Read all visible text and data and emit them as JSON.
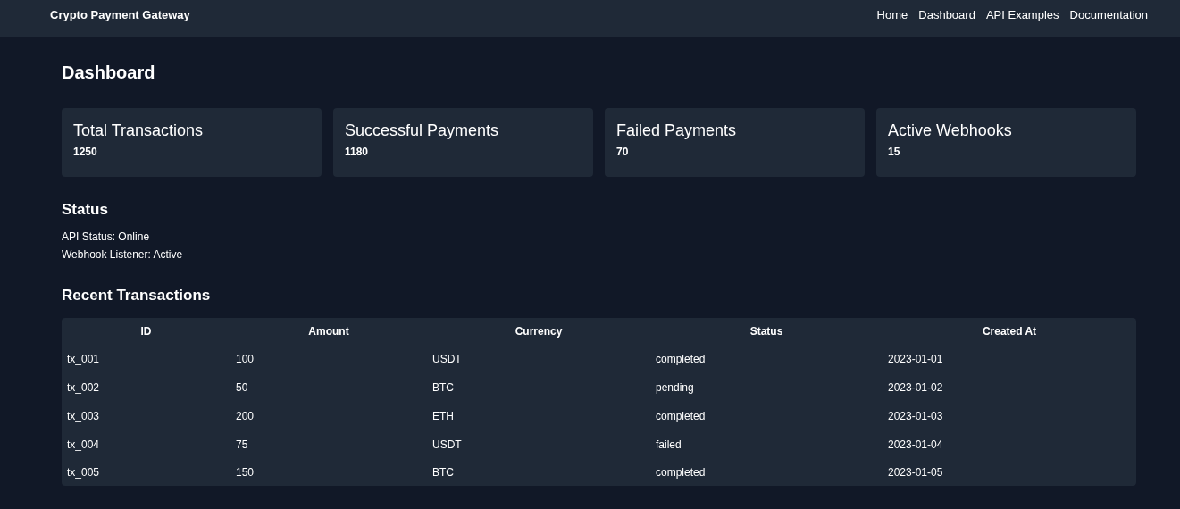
{
  "navbar": {
    "brand": "Crypto Payment Gateway",
    "links": [
      "Home",
      "Dashboard",
      "API Examples",
      "Documentation"
    ]
  },
  "page_title": "Dashboard",
  "stats": [
    {
      "label": "Total Transactions",
      "value": "1250"
    },
    {
      "label": "Successful Payments",
      "value": "1180"
    },
    {
      "label": "Failed Payments",
      "value": "70"
    },
    {
      "label": "Active Webhooks",
      "value": "15"
    }
  ],
  "status": {
    "heading": "Status",
    "lines": [
      "API Status: Online",
      "Webhook Listener: Active"
    ]
  },
  "recent_transactions": {
    "heading": "Recent Transactions",
    "columns": [
      "ID",
      "Amount",
      "Currency",
      "Status",
      "Created At"
    ],
    "rows": [
      [
        "tx_001",
        "100",
        "USDT",
        "completed",
        "2023-01-01"
      ],
      [
        "tx_002",
        "50",
        "BTC",
        "pending",
        "2023-01-02"
      ],
      [
        "tx_003",
        "200",
        "ETH",
        "completed",
        "2023-01-03"
      ],
      [
        "tx_004",
        "75",
        "USDT",
        "failed",
        "2023-01-04"
      ],
      [
        "tx_005",
        "150",
        "BTC",
        "completed",
        "2023-01-05"
      ]
    ]
  }
}
